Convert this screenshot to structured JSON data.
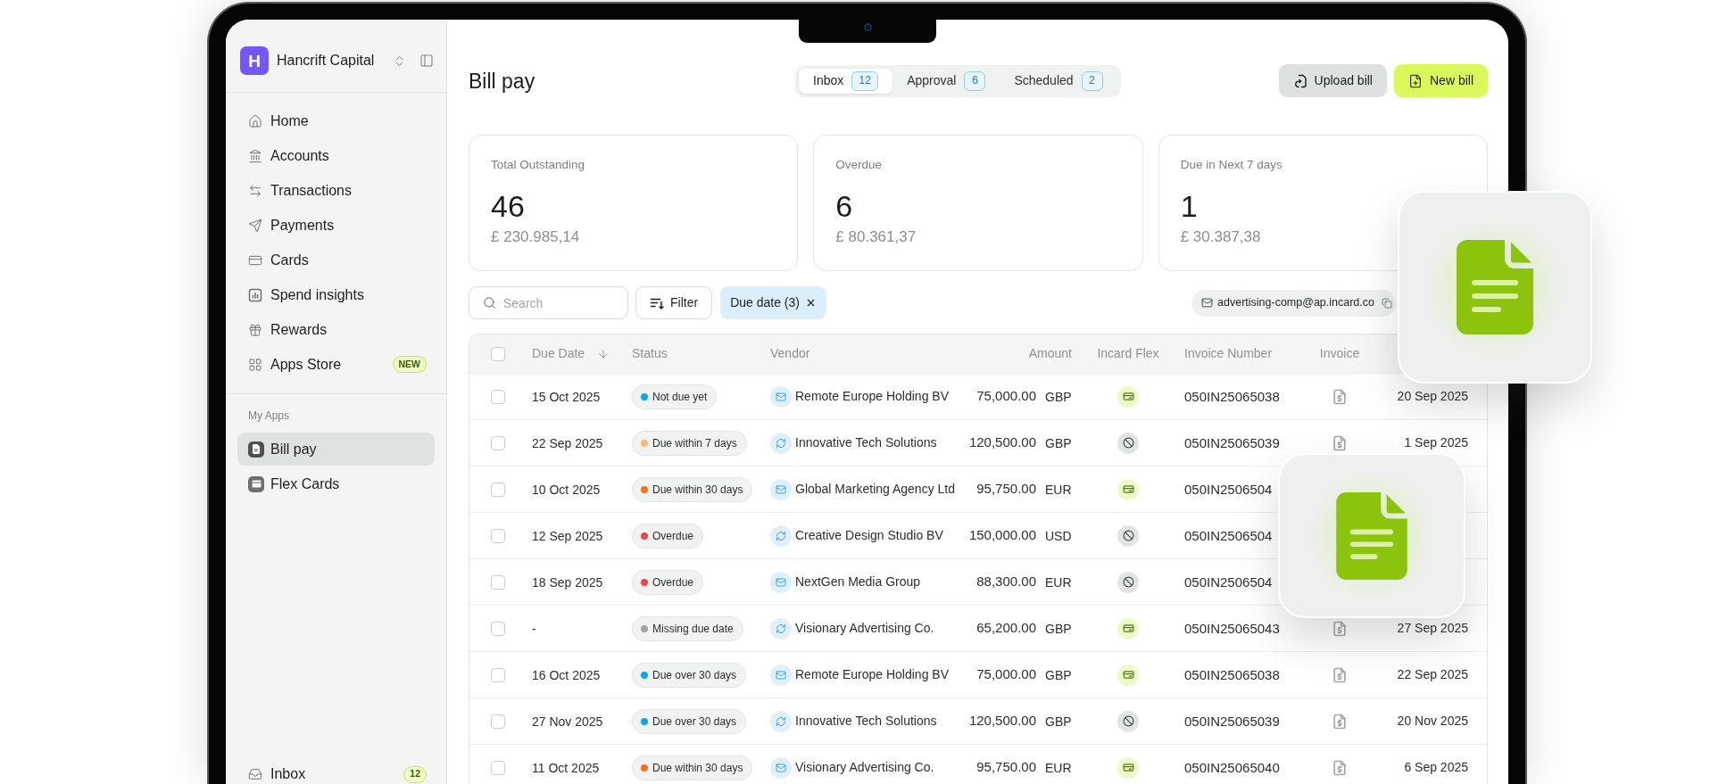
{
  "sidebar": {
    "workspace": {
      "logo_letter": "H",
      "name": "Hancrift Capital"
    },
    "nav_items": [
      {
        "label": "Home",
        "selected": false
      },
      {
        "label": "Accounts",
        "selected": false
      },
      {
        "label": "Transactions",
        "selected": false
      },
      {
        "label": "Payments",
        "selected": false
      },
      {
        "label": "Cards",
        "selected": false
      },
      {
        "label": "Spend insights",
        "selected": false
      },
      {
        "label": "Rewards",
        "selected": false
      },
      {
        "label": "Apps Store",
        "selected": false,
        "badge": "NEW"
      }
    ],
    "apps_section": {
      "label": "My Apps",
      "items": [
        {
          "label": "Bill pay",
          "selected": true
        },
        {
          "label": "Flex Cards",
          "selected": false
        }
      ]
    },
    "footer_items": [
      {
        "label": "Inbox",
        "selected": false,
        "badge": "12"
      }
    ]
  },
  "header": {
    "title": "Bill pay",
    "tabs": [
      {
        "label": "Inbox",
        "count": "12",
        "selected": true
      },
      {
        "label": "Approval",
        "count": "6",
        "selected": false
      },
      {
        "label": "Scheduled",
        "count": "2",
        "selected": false
      }
    ],
    "buttons": [
      {
        "label": "Upload bill",
        "kind": "secondary"
      },
      {
        "label": "New bill",
        "kind": "primary"
      }
    ]
  },
  "stats": [
    {
      "label": "Total Outstanding",
      "count": "46",
      "amount": "£ 230.985,14"
    },
    {
      "label": "Overdue",
      "count": "6",
      "amount": "£ 80.361,37"
    },
    {
      "label": "Due in Next 7 days",
      "count": "1",
      "amount": "£ 30.387,38"
    }
  ],
  "toolbar": {
    "search": {
      "placeholder": "Search"
    },
    "filter_button": "Filter",
    "chips": [
      {
        "label": "Due date (3)"
      }
    ],
    "email": "advertising-comp@ap.incard.co"
  },
  "table": {
    "select_all": {
      "checked": false
    },
    "columns": [
      {
        "label": "Due Date",
        "sorted": true
      },
      {
        "label": "Status",
        "sorted": false
      },
      {
        "label": "Vendor",
        "sorted": false
      },
      {
        "label": "Amount",
        "sorted": false
      },
      {
        "label": "Incard Flex",
        "sorted": false
      },
      {
        "label": "Invoice Number",
        "sorted": false
      },
      {
        "label": "Invoice",
        "sorted": false
      }
    ],
    "rows": [
      {
        "checked": false,
        "due_date": "15 Oct 2025",
        "status": {
          "label": "Not due yet",
          "color": "#0ea5e9"
        },
        "vendor": {
          "name": "Remote Europe Holding BV",
          "kind": "email"
        },
        "amount": "75,000.00",
        "currency": "GBP",
        "incard_flex": true,
        "invoice_number": "050IN25065038",
        "invoice_file": true,
        "column_8": "20 Sep 2025"
      },
      {
        "checked": false,
        "due_date": "22 Sep 2025",
        "status": {
          "label": "Due within 7 days",
          "color": "#fdba74"
        },
        "vendor": {
          "name": "Innovative Tech Solutions",
          "kind": "sync"
        },
        "amount": "120,500.00",
        "currency": "GBP",
        "incard_flex": false,
        "invoice_number": "050IN25065039",
        "invoice_file": true,
        "column_8": "1 Sep 2025"
      },
      {
        "checked": false,
        "due_date": "10 Oct 2025",
        "status": {
          "label": "Due within 30 days",
          "color": "#f97316"
        },
        "vendor": {
          "name": "Global Marketing Agency Ltd",
          "kind": "email"
        },
        "amount": "95,750.00",
        "currency": "EUR",
        "incard_flex": true,
        "invoice_number": "050IN2506504"
      },
      {
        "checked": false,
        "due_date": "12 Sep 2025",
        "status": {
          "label": "Overdue",
          "color": "#ef4444"
        },
        "vendor": {
          "name": "Creative Design Studio BV",
          "kind": "sync"
        },
        "amount": "150,000.00",
        "currency": "USD",
        "incard_flex": false,
        "invoice_number": "050IN2506504"
      },
      {
        "checked": false,
        "due_date": "18 Sep 2025",
        "status": {
          "label": "Overdue",
          "color": "#ef4444"
        },
        "vendor": {
          "name": "NextGen Media Group",
          "kind": "email"
        },
        "amount": "88,300.00",
        "currency": "EUR",
        "incard_flex": false,
        "invoice_number": "050IN2506504"
      },
      {
        "checked": false,
        "due_date": "-",
        "status": {
          "label": "Missing due date",
          "color": "#a3a3a3"
        },
        "vendor": {
          "name": "Visionary Advertising Co.",
          "kind": "sync"
        },
        "amount": "65,200.00",
        "currency": "GBP",
        "incard_flex": true,
        "invoice_number": "050IN25065043",
        "invoice_file": true,
        "column_8": "27 Sep 2025"
      },
      {
        "checked": false,
        "due_date": "16 Oct 2025",
        "status": {
          "label": "Due over 30 days",
          "color": "#0ea5e9"
        },
        "vendor": {
          "name": "Remote Europe Holding BV",
          "kind": "email"
        },
        "amount": "75,000.00",
        "currency": "GBP",
        "incard_flex": true,
        "invoice_number": "050IN25065038",
        "invoice_file": true,
        "column_8": "22 Sep 2025"
      },
      {
        "checked": false,
        "due_date": "27 Nov 2025",
        "status": {
          "label": "Due over 30 days",
          "color": "#0ea5e9"
        },
        "vendor": {
          "name": "Innovative Tech Solutions",
          "kind": "sync"
        },
        "amount": "120,500.00",
        "currency": "GBP",
        "incard_flex": false,
        "invoice_number": "050IN25065039",
        "invoice_file": true,
        "column_8": "20 Nov 2025"
      },
      {
        "checked": false,
        "due_date": "11 Oct 2025",
        "status": {
          "label": "Due within 30 days",
          "color": "#f97316"
        },
        "vendor": {
          "name": "Visionary Advertising Co.",
          "kind": "email"
        },
        "amount": "95,750.00",
        "currency": "EUR",
        "incard_flex": true,
        "invoice_number": "050IN25065040",
        "invoice_file": true,
        "column_8": "6 Sep 2025"
      }
    ]
  }
}
